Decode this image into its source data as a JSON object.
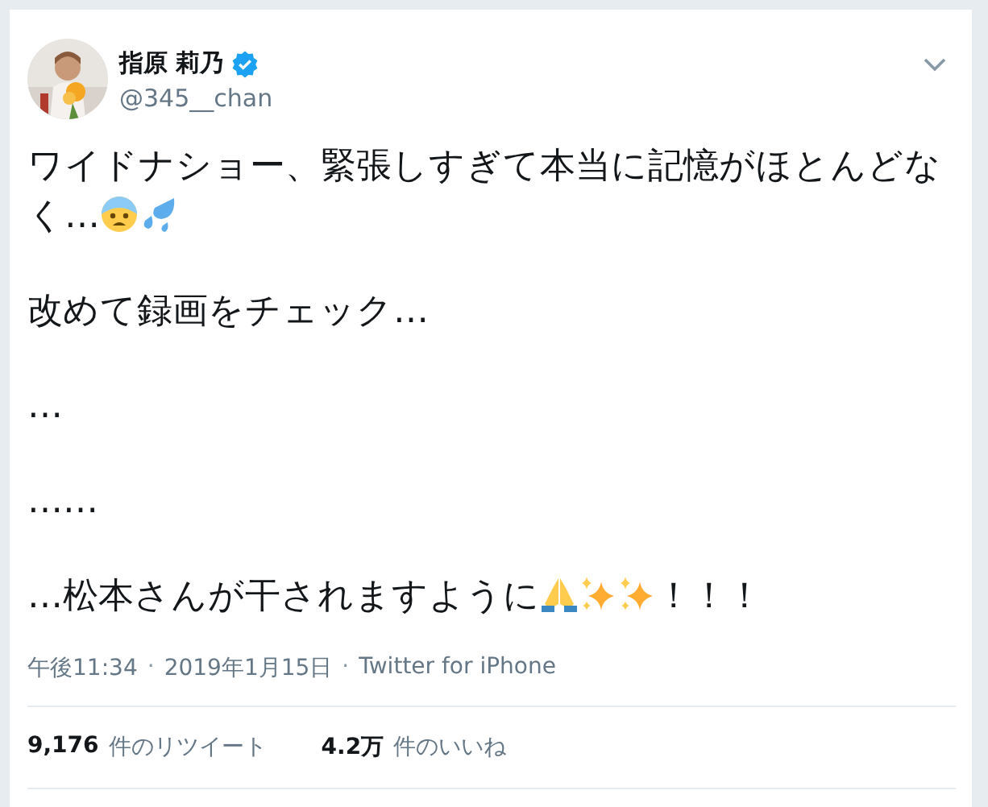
{
  "author": {
    "name": "指原 莉乃",
    "verified": true,
    "handle": "@345__chan"
  },
  "paragraphs": [
    [
      {
        "kind": "text",
        "text": "ワイドナショー、緊張しすぎて本当に記憶がほとんどな"
      },
      {
        "kind": "break"
      },
      {
        "kind": "text",
        "text": "く…"
      },
      {
        "kind": "fearful"
      },
      {
        "kind": "sweat"
      }
    ],
    [
      {
        "kind": "text",
        "text": "改めて録画をチェック…"
      }
    ],
    [
      {
        "kind": "text",
        "text": "…"
      }
    ],
    [
      {
        "kind": "text",
        "text": "……"
      }
    ],
    [
      {
        "kind": "text",
        "text": "…松本さんが干されますように"
      },
      {
        "kind": "pray"
      },
      {
        "kind": "sparkles"
      },
      {
        "kind": "sparkles"
      },
      {
        "kind": "text",
        "text": "！！！"
      }
    ]
  ],
  "meta": [
    {
      "kind": "text",
      "text": "午後11:34"
    },
    {
      "kind": "separator",
      "text": "·"
    },
    {
      "kind": "text",
      "text": "2019年1月15日"
    },
    {
      "kind": "separator",
      "text": "·"
    },
    {
      "kind": "text",
      "text": "Twitter for iPhone"
    }
  ],
  "stats": [
    {
      "count": "9,176",
      "label": "件のリツイート"
    },
    {
      "count": "4.2万",
      "label": "件のいいね"
    }
  ]
}
